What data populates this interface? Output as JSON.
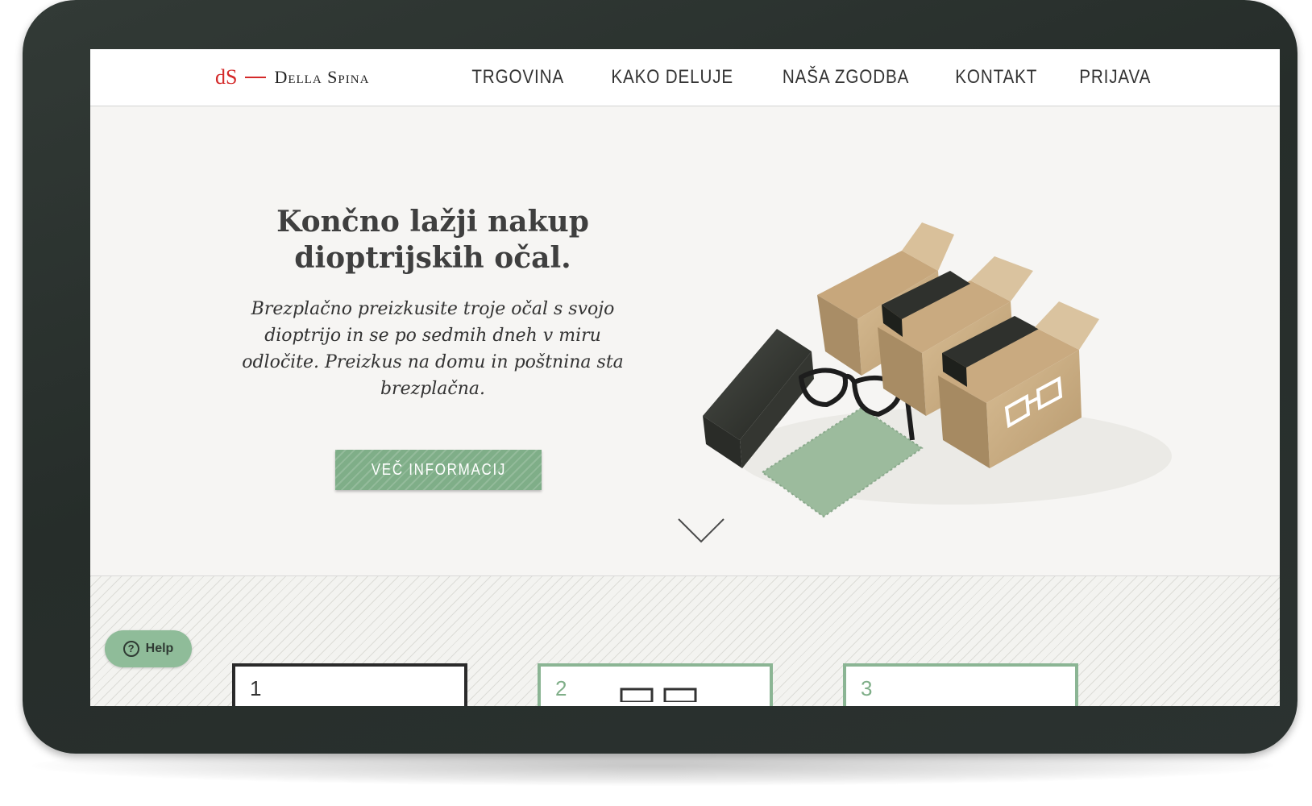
{
  "brand": {
    "mark": "dS",
    "name": "Della Spina"
  },
  "nav": [
    {
      "label": "TRGOVINA"
    },
    {
      "label": "KAKO DELUJE"
    },
    {
      "label": "NAŠA ZGODBA"
    },
    {
      "label": "KONTAKT"
    },
    {
      "label": "PRIJAVA"
    }
  ],
  "hero": {
    "title": "Končno lažji nakup dioptrijskih očal.",
    "text": "Brezplačno preizkusite troje očal s svojo dioptrijo in se po sedmih dneh v miru odločite. Preizkus na domu in poštnina sta brezplačna.",
    "cta": "VEČ INFORMACIJ"
  },
  "steps": [
    {
      "number": "1",
      "state": "active"
    },
    {
      "number": "2",
      "state": "inactive"
    },
    {
      "number": "3",
      "state": "inactive"
    }
  ],
  "help": {
    "label": "Help",
    "icon": "question-circle-icon"
  },
  "colors": {
    "accent": "#7fae88",
    "brand_red": "#d42a2a",
    "frame": "#2b3230"
  }
}
